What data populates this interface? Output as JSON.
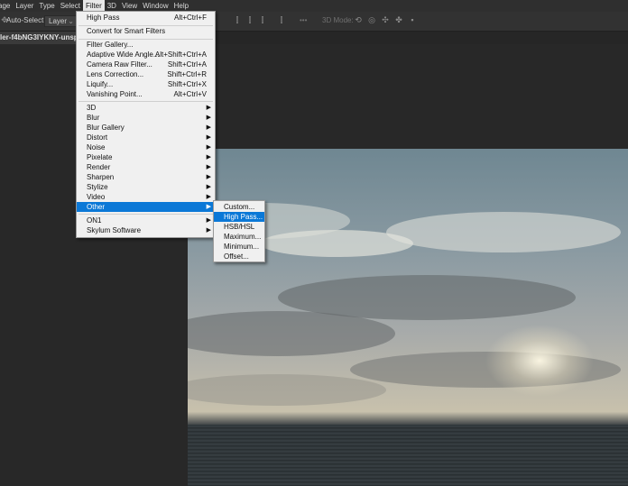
{
  "menubar": {
    "items": [
      "age",
      "Layer",
      "Type",
      "Select",
      "Filter",
      "3D",
      "View",
      "Window",
      "Help"
    ],
    "active": "Filter"
  },
  "options": {
    "auto_select_label": "Auto-Select:",
    "layer_value": "Layer",
    "mode_3d_label": "3D Mode:",
    "more_label": "•••"
  },
  "document": {
    "tab_title": "ler-f4bNG3IYKNY-unsplash.j"
  },
  "filter_menu": {
    "items": [
      {
        "label": "High Pass",
        "shortcut": "Alt+Ctrl+F"
      },
      {
        "label": "Convert for Smart Filters",
        "shortcut": ""
      },
      {
        "label": "Filter Gallery...",
        "shortcut": ""
      },
      {
        "label": "Adaptive Wide Angle...",
        "shortcut": "Alt+Shift+Ctrl+A"
      },
      {
        "label": "Camera Raw Filter...",
        "shortcut": "Shift+Ctrl+A"
      },
      {
        "label": "Lens Correction...",
        "shortcut": "Shift+Ctrl+R"
      },
      {
        "label": "Liquify...",
        "shortcut": "Shift+Ctrl+X"
      },
      {
        "label": "Vanishing Point...",
        "shortcut": "Alt+Ctrl+V"
      },
      {
        "label": "3D"
      },
      {
        "label": "Blur"
      },
      {
        "label": "Blur Gallery"
      },
      {
        "label": "Distort"
      },
      {
        "label": "Noise"
      },
      {
        "label": "Pixelate"
      },
      {
        "label": "Render"
      },
      {
        "label": "Sharpen"
      },
      {
        "label": "Stylize"
      },
      {
        "label": "Video"
      },
      {
        "label": "Other"
      },
      {
        "label": "ON1"
      },
      {
        "label": "Skylum Software"
      }
    ]
  },
  "other_submenu": {
    "items": [
      "Custom...",
      "High Pass...",
      "HSB/HSL",
      "Maximum...",
      "Minimum...",
      "Offset..."
    ],
    "highlighted": "High Pass..."
  },
  "colors": {
    "menu_highlight": "#0b78d7",
    "menu_bg": "#f0f0f0",
    "app_bg": "#282828"
  }
}
